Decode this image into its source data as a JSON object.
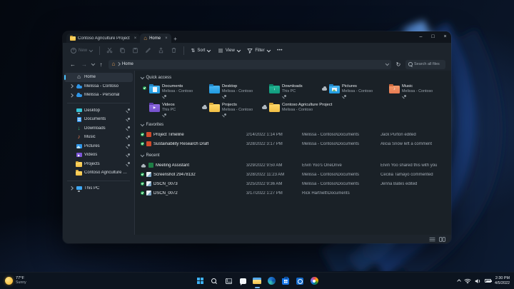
{
  "window": {
    "tabs": [
      {
        "label": "Contoso Agriculture Project",
        "close": "×"
      },
      {
        "label": "Home",
        "close": "×"
      }
    ],
    "new_tab": "+",
    "controls": {
      "minimize": "–",
      "maximize": "□",
      "close": "×"
    },
    "toolbar": {
      "new": "New",
      "sort": "Sort",
      "view": "View",
      "filter": "Filter",
      "more": "•••",
      "sort_glyph": "⇅"
    },
    "nav": {
      "back": "←",
      "forward": "→",
      "up": "↑",
      "refresh": "↻"
    },
    "address": {
      "home_glyph": "⌂",
      "crumb": "Home"
    },
    "search_placeholder": "Search all files",
    "sidebar": [
      {
        "label": "Home"
      },
      {
        "label": "Melissa - Contoso"
      },
      {
        "label": "Melissa - Personal"
      },
      {
        "label": "Desktop"
      },
      {
        "label": "Documents"
      },
      {
        "label": "Downloads"
      },
      {
        "label": "Music"
      },
      {
        "label": "Pictures"
      },
      {
        "label": "Videos"
      },
      {
        "label": "Projects"
      },
      {
        "label": "Contoso Agriculture Project"
      },
      {
        "label": "This PC"
      }
    ],
    "icons": {
      "download_arrow": "↓",
      "music_note": "♪",
      "play": "▶"
    },
    "quick_access": {
      "title": "Quick access",
      "tiles": [
        {
          "name": "Documents",
          "location": "Melissa - Contoso"
        },
        {
          "name": "Desktop",
          "location": "Melissa - Contoso"
        },
        {
          "name": "Downloads",
          "location": "This PC"
        },
        {
          "name": "Pictures",
          "location": "Melissa - Contoso"
        },
        {
          "name": "Music",
          "location": "Melissa - Contoso"
        },
        {
          "name": "Videos",
          "location": "This PC"
        },
        {
          "name": "Projects",
          "location": "Melissa - Contoso"
        },
        {
          "name": "Contoso Agriculture Project",
          "location": "Melissa - Contoso"
        }
      ]
    },
    "favorites": {
      "title": "Favorites",
      "rows": [
        {
          "name": "Project Timeline",
          "date": "2/14/2022 1:14 PM",
          "location": "Melissa - Contoso\\Documents",
          "activity": "Jack Purton edited"
        },
        {
          "name": "Sustainability Research Draft",
          "date": "3/28/2022 3:17 PM",
          "location": "Melissa - Contoso\\Documents",
          "activity": "Alicia Snow left a comment"
        }
      ]
    },
    "recent": {
      "title": "Recent",
      "rows": [
        {
          "name": "Meeting Assistant",
          "date": "3/29/2022 9:50 AM",
          "location": "Elvin Yoo's OneDrive",
          "activity": "Elvin Yoo shared this with you"
        },
        {
          "name": "Screenshot 29478132",
          "date": "3/28/2022 11:23 AM",
          "location": "Melissa - Contoso\\Documents",
          "activity": "Cecilia Tamayo commented"
        },
        {
          "name": "DSCN_0073",
          "date": "3/25/2022 9:36 AM",
          "location": "Melissa - Contoso\\Documents",
          "activity": "Jenna Bates edited"
        },
        {
          "name": "DSCN_0072",
          "date": "3/17/2022 1:27 PM",
          "location": "Rick Hartnett\\Documents",
          "activity": ""
        }
      ]
    }
  },
  "taskbar": {
    "weather": {
      "temp": "77°F",
      "condition": "Sunny"
    },
    "tray": {
      "time": "2:30 PM",
      "date": "4/5/2022"
    }
  },
  "colors": {
    "accent_blue": "#4cc2ff",
    "folder_yellow": "#f3c94e",
    "folder_blue": "#2fa7ea",
    "downloads_green": "#12a789",
    "music_orange": "#ef8052",
    "videos_purple": "#7d55d8",
    "status_green": "#17a34a",
    "window_bg": "#1d242c",
    "wallpaper_ribbon": "#3f7de0"
  }
}
